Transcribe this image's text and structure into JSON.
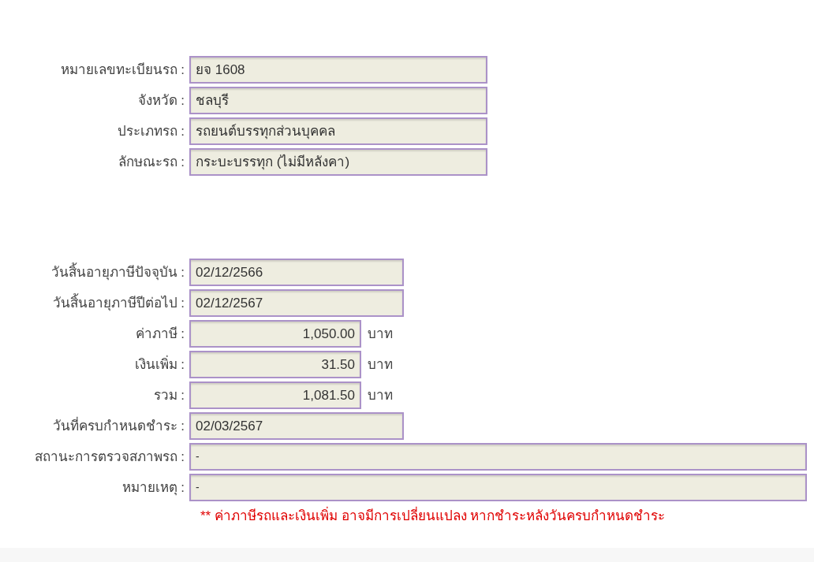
{
  "sections": [
    {
      "rows": [
        {
          "kind": "text",
          "label": "หมายเลขทะเบียนรถ :",
          "value": "ยจ 1608"
        },
        {
          "kind": "text",
          "label": "จังหวัด :",
          "value": "ชลบุรี"
        },
        {
          "kind": "text",
          "label": "ประเภทรถ :",
          "value": "รถยนต์บรรทุกส่วนบุคคล"
        },
        {
          "kind": "text",
          "label": "ลักษณะรถ :",
          "value": "กระบะบรรทุก (ไม่มีหลังคา)"
        }
      ]
    },
    {
      "rows": [
        {
          "kind": "text",
          "label": "วันสิ้นอายุภาษีปัจจุบัน :",
          "value": "02/12/2566"
        },
        {
          "kind": "text",
          "label": "วันสิ้นอายุภาษีปีต่อไป :",
          "value": "02/12/2567"
        },
        {
          "kind": "amount",
          "label": "ค่าภาษี :",
          "value": "1,050.00",
          "unit": "บาท"
        },
        {
          "kind": "amount",
          "label": "เงินเพิ่ม :",
          "value": "31.50",
          "unit": "บาท"
        },
        {
          "kind": "amount",
          "label": "รวม :",
          "value": "1,081.50",
          "unit": "บาท"
        },
        {
          "kind": "text",
          "label": "วันที่ครบกำหนดชำระ :",
          "value": "02/03/2567"
        },
        {
          "kind": "wide",
          "label": "สถานะการตรวจสภาพรถ :",
          "value": "-"
        },
        {
          "kind": "wide",
          "label": "หมายเหตุ :",
          "value": "-"
        }
      ]
    }
  ],
  "note": "** ค่าภาษีรถและเงินเพิ่ม อาจมีการเปลี่ยนแปลง หากชำระหลังวันครบกำหนดชำระ"
}
